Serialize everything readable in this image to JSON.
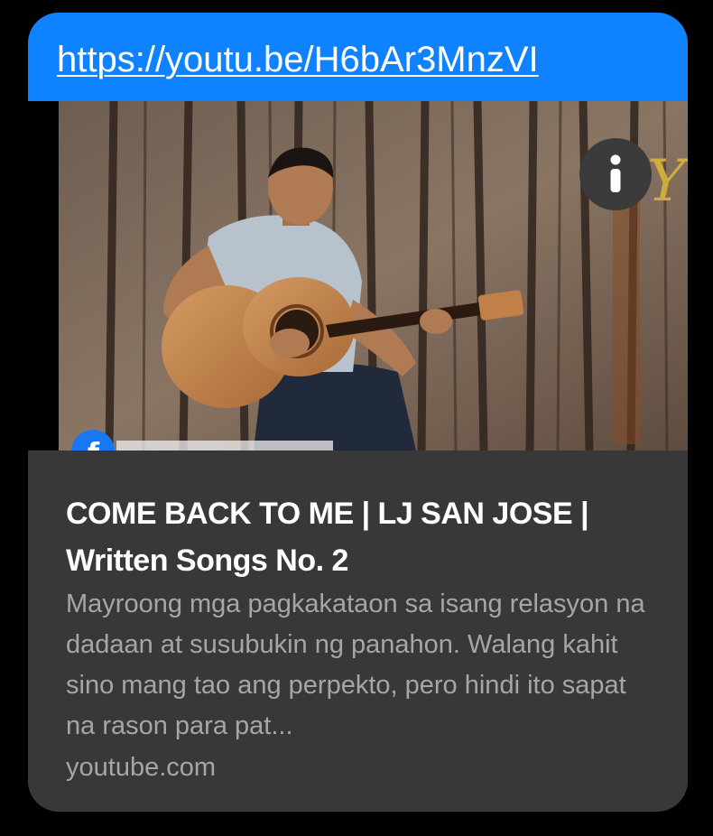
{
  "colors": {
    "page_background": "#000000",
    "url_bar": "#0f82ff",
    "card_background": "#383838",
    "title_text": "#ffffff",
    "secondary_text": "#a6a6a6"
  },
  "message": {
    "url": "https://youtu.be/H6bAr3MnzVI",
    "preview": {
      "thumbnail": {
        "icon": "info-icon",
        "badge_icon": "facebook-icon",
        "scene": "man playing acoustic guitar against a wooden wall"
      },
      "title": "COME BACK TO ME | LJ SAN JOSE | Written Songs No. 2",
      "description": "Mayroong mga pagkakataon sa isang relasyon na dadaan at susubukin ng panahon. Walang kahit sino mang tao ang perpekto, pero hindi ito sapat na rason para pat...",
      "domain": "youtube.com"
    }
  }
}
